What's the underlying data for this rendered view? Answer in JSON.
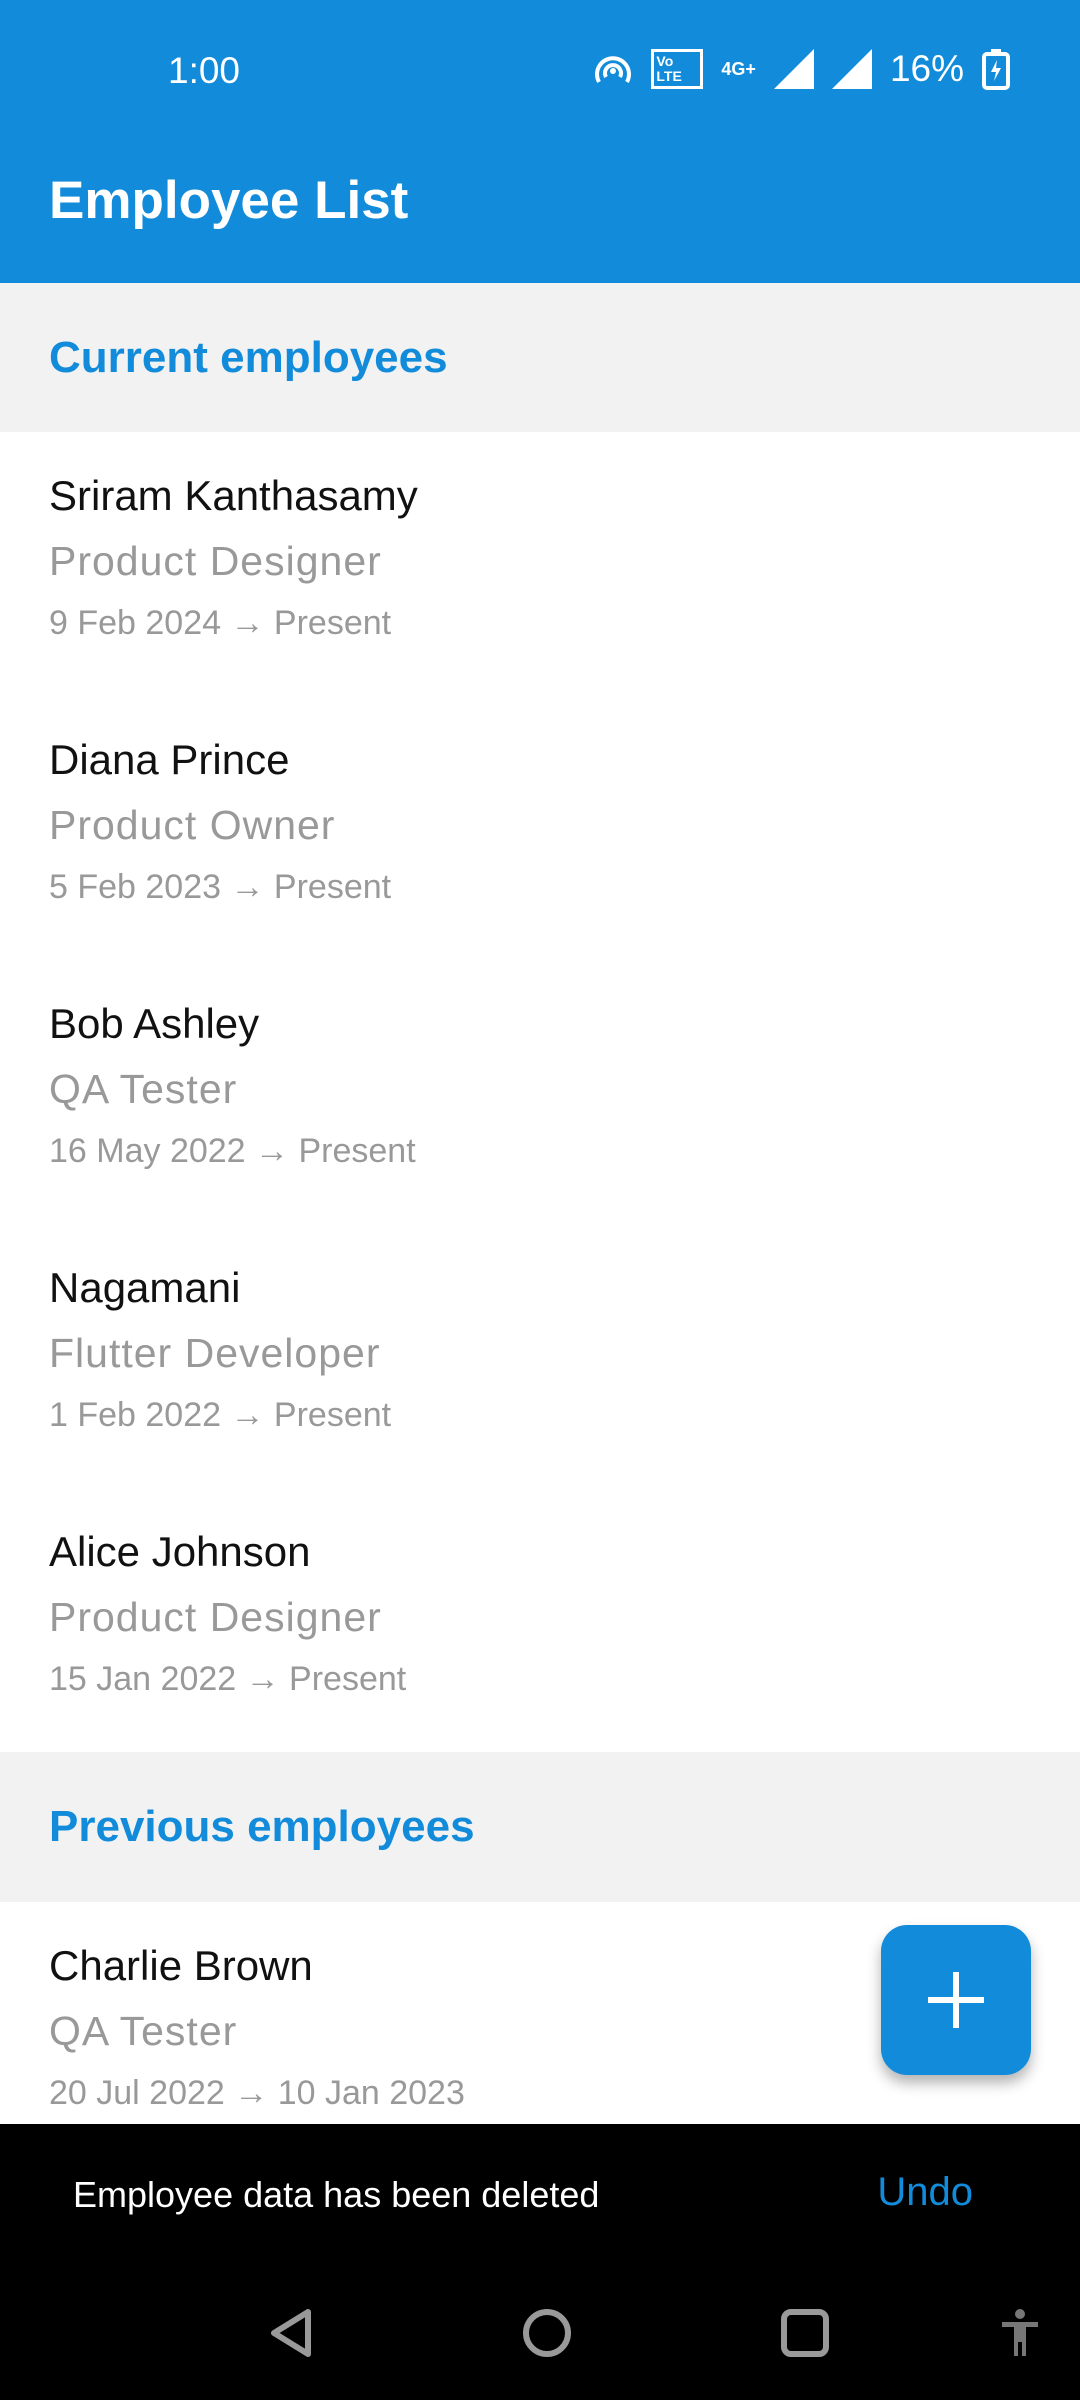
{
  "status_bar": {
    "time": "1:00",
    "battery": "16%",
    "network": "4G+",
    "volte": "Vo LTE"
  },
  "app_bar": {
    "title": "Employee List"
  },
  "sections": [
    {
      "title": "Current employees",
      "employees": [
        {
          "name": "Sriram Kanthasamy",
          "role": "Product Designer",
          "dates": "9 Feb 2024 → Present"
        },
        {
          "name": "Diana Prince",
          "role": "Product Owner",
          "dates": "5 Feb 2023 → Present"
        },
        {
          "name": "Bob Ashley",
          "role": "QA Tester",
          "dates": "16 May 2022 → Present"
        },
        {
          "name": "Nagamani",
          "role": "Flutter Developer",
          "dates": "1 Feb 2022 → Present"
        },
        {
          "name": "Alice Johnson",
          "role": "Product Designer",
          "dates": "15 Jan 2022 → Present"
        }
      ]
    },
    {
      "title": "Previous employees",
      "employees": [
        {
          "name": "Charlie Brown",
          "role": "QA Tester",
          "dates": "20 Jul 2022 → 10 Jan 2023"
        }
      ]
    }
  ],
  "snackbar": {
    "message": "Employee data has been deleted",
    "action": "Undo"
  },
  "colors": {
    "primary": "#128cda"
  }
}
